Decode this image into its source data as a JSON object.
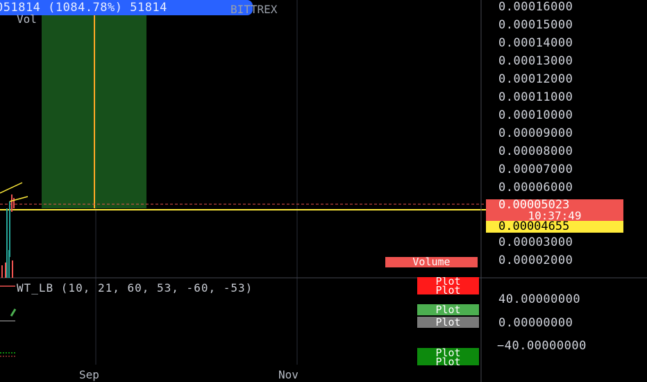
{
  "header": {
    "banner_text": "051814 (1084.78%) 51814",
    "exchange": "BITTREX",
    "vol_label": "Vol",
    "indicator_label": "WT_LB (10, 21, 60, 53, -60, -53)"
  },
  "badges": {
    "volume": "Volume",
    "plots": [
      "Plot",
      "Plot",
      "Plot",
      "Plot",
      "Plot",
      "Plot"
    ]
  },
  "price_axis": {
    "ticks": [
      "0.00016000",
      "0.00015000",
      "0.00014000",
      "0.00013000",
      "0.00012000",
      "0.00011000",
      "0.00010000",
      "0.00009000",
      "0.00008000",
      "0.00007000",
      "0.00006000",
      "0.00003000",
      "0.00002000"
    ],
    "current_price": "0.00005023",
    "countdown": "10:37:49",
    "marked_price": "0.00004655"
  },
  "osc_axis": {
    "ticks": [
      "40.00000000",
      "0.00000000",
      "−40.00000000"
    ]
  },
  "time_axis": {
    "labels": [
      "Sep",
      "Nov"
    ]
  },
  "colors": {
    "background": "#000000",
    "grid": "#2a2e39",
    "red": "#ef5350",
    "green_zone": "#1b5e20",
    "orange": "#ffa726",
    "yellow": "#ffeb3b",
    "plot_red": "#ff1a1a",
    "plot_green": "#4caf50",
    "plot_gray": "#7a7a7a",
    "plot_dark_green": "#0d8a0d"
  },
  "chart_data": {
    "type": "line",
    "price_ticks": [
      0.00016,
      0.00015,
      0.00014,
      0.00013,
      0.00012,
      0.00011,
      0.0001,
      9e-05,
      8e-05,
      7e-05,
      6e-05,
      3e-05,
      2e-05
    ],
    "current_price": 5.023e-05,
    "marked_price": 4.655e-05,
    "osc_ticks": [
      40,
      0,
      -40
    ],
    "x_labels": [
      "Sep",
      "Nov"
    ]
  }
}
